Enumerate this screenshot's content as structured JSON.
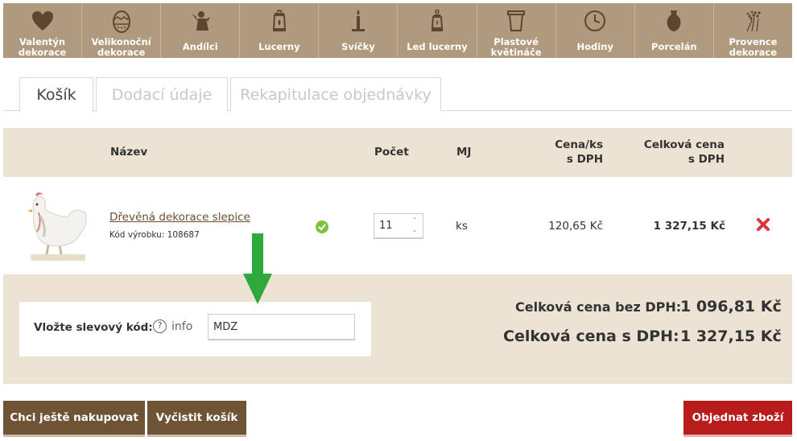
{
  "categories": [
    {
      "label": "Valentýn\ndekorace",
      "icon": "heart-icon"
    },
    {
      "label": "Velikonoční\ndekorace",
      "icon": "easter-egg-icon"
    },
    {
      "label": "Andílci",
      "icon": "angel-icon"
    },
    {
      "label": "Lucerny",
      "icon": "lantern-icon"
    },
    {
      "label": "Svíčky",
      "icon": "candle-icon"
    },
    {
      "label": "Led lucerny",
      "icon": "led-lantern-icon"
    },
    {
      "label": "Plastové\nkvětináče",
      "icon": "flowerpot-icon"
    },
    {
      "label": "Hodiny",
      "icon": "clock-icon"
    },
    {
      "label": "Porcelán",
      "icon": "vase-icon"
    },
    {
      "label": "Provence\ndekorace",
      "icon": "lavender-icon"
    }
  ],
  "tabs": {
    "cart": "Košík",
    "delivery": "Dodací údaje",
    "summary": "Rekapitulace objednávky"
  },
  "table": {
    "col_name": "Název",
    "col_qty": "Počet",
    "col_unit": "MJ",
    "col_price": "Cena/ks\ns DPH",
    "col_total": "Celková cena\ns DPH"
  },
  "item": {
    "name": "Dřevěná dekorace slepice",
    "code": "Kód výrobku: 108687",
    "qty": "11",
    "unit": "ks",
    "price": "120,65 Kč",
    "total": "1 327,15 Kč"
  },
  "discount": {
    "label": "Vložte slevový kód:",
    "info": "info",
    "value": "MDZ"
  },
  "totals": {
    "without_vat_label": "Celková cena bez DPH:",
    "without_vat_value": "1 096,81 Kč",
    "with_vat_label": "Celková cena s DPH:",
    "with_vat_value": "1 327,15 Kč"
  },
  "buttons": {
    "continue": "Chci ještě nakupovat",
    "clear": "Vyčistit košík",
    "order": "Objednat zboží"
  },
  "colors": {
    "nav_bg": "#b09a7e",
    "beige": "#ede3d4",
    "brown_button": "#6e5435",
    "red_button": "#b81c1c",
    "arrow": "#2eaa3c"
  }
}
